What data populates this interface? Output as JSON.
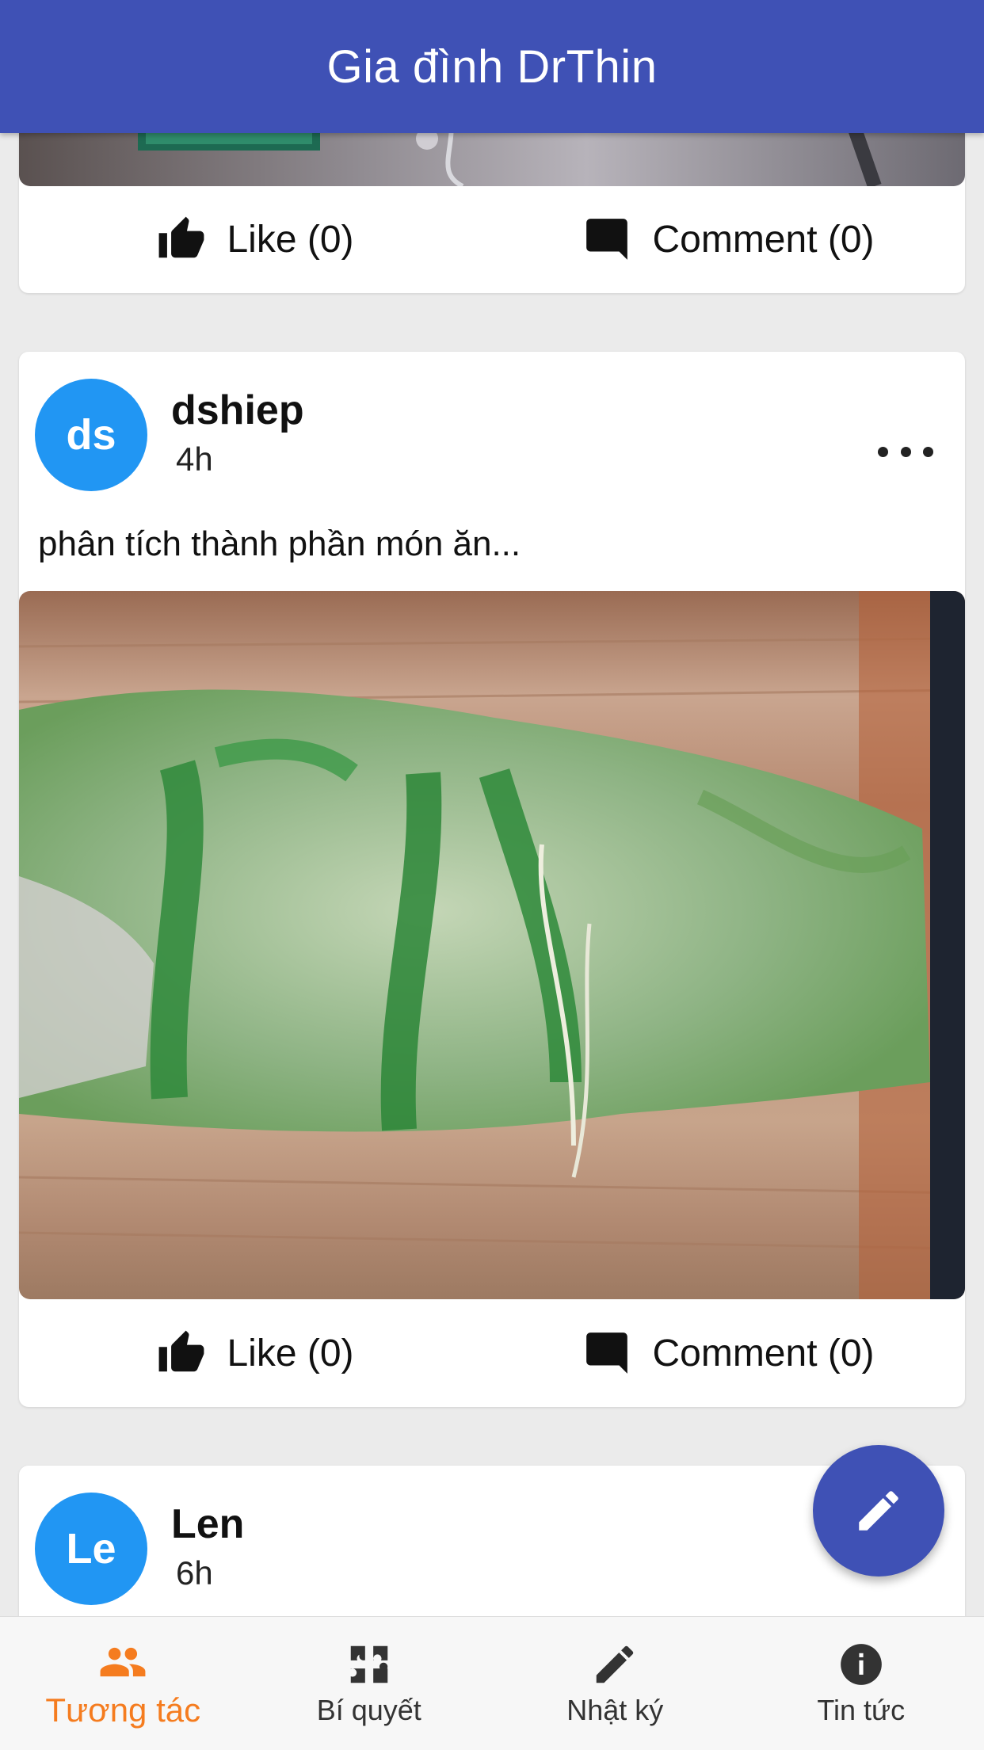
{
  "app": {
    "title": "Gia đình DrThin"
  },
  "colors": {
    "app_bar": "#3f51b5",
    "avatar": "#2196f3",
    "active_tab": "#f57c1f",
    "fab": "#3f51b5"
  },
  "posts": [
    {
      "partial": true,
      "image_icon": "photo-banner-icon",
      "like_label": "Like (0)",
      "comment_label": "Comment (0)"
    },
    {
      "avatar_initials": "ds",
      "author": "dshiep",
      "time": "4h",
      "text": "phân tích thành phần món ăn...",
      "image_icon": "food-photo-icon",
      "like_label": "Like (0)",
      "comment_label": "Comment (0)"
    },
    {
      "avatar_initials": "Le",
      "author": "Len",
      "time": "6h"
    }
  ],
  "fab": {
    "icon": "pencil-icon"
  },
  "bottom_nav": [
    {
      "label": "Tương tác",
      "icon": "people-icon",
      "active": true
    },
    {
      "label": "Bí quyết",
      "icon": "puzzle-icon",
      "active": false
    },
    {
      "label": "Nhật ký",
      "icon": "pencil-icon",
      "active": false
    },
    {
      "label": "Tin tức",
      "icon": "info-icon",
      "active": false
    }
  ]
}
